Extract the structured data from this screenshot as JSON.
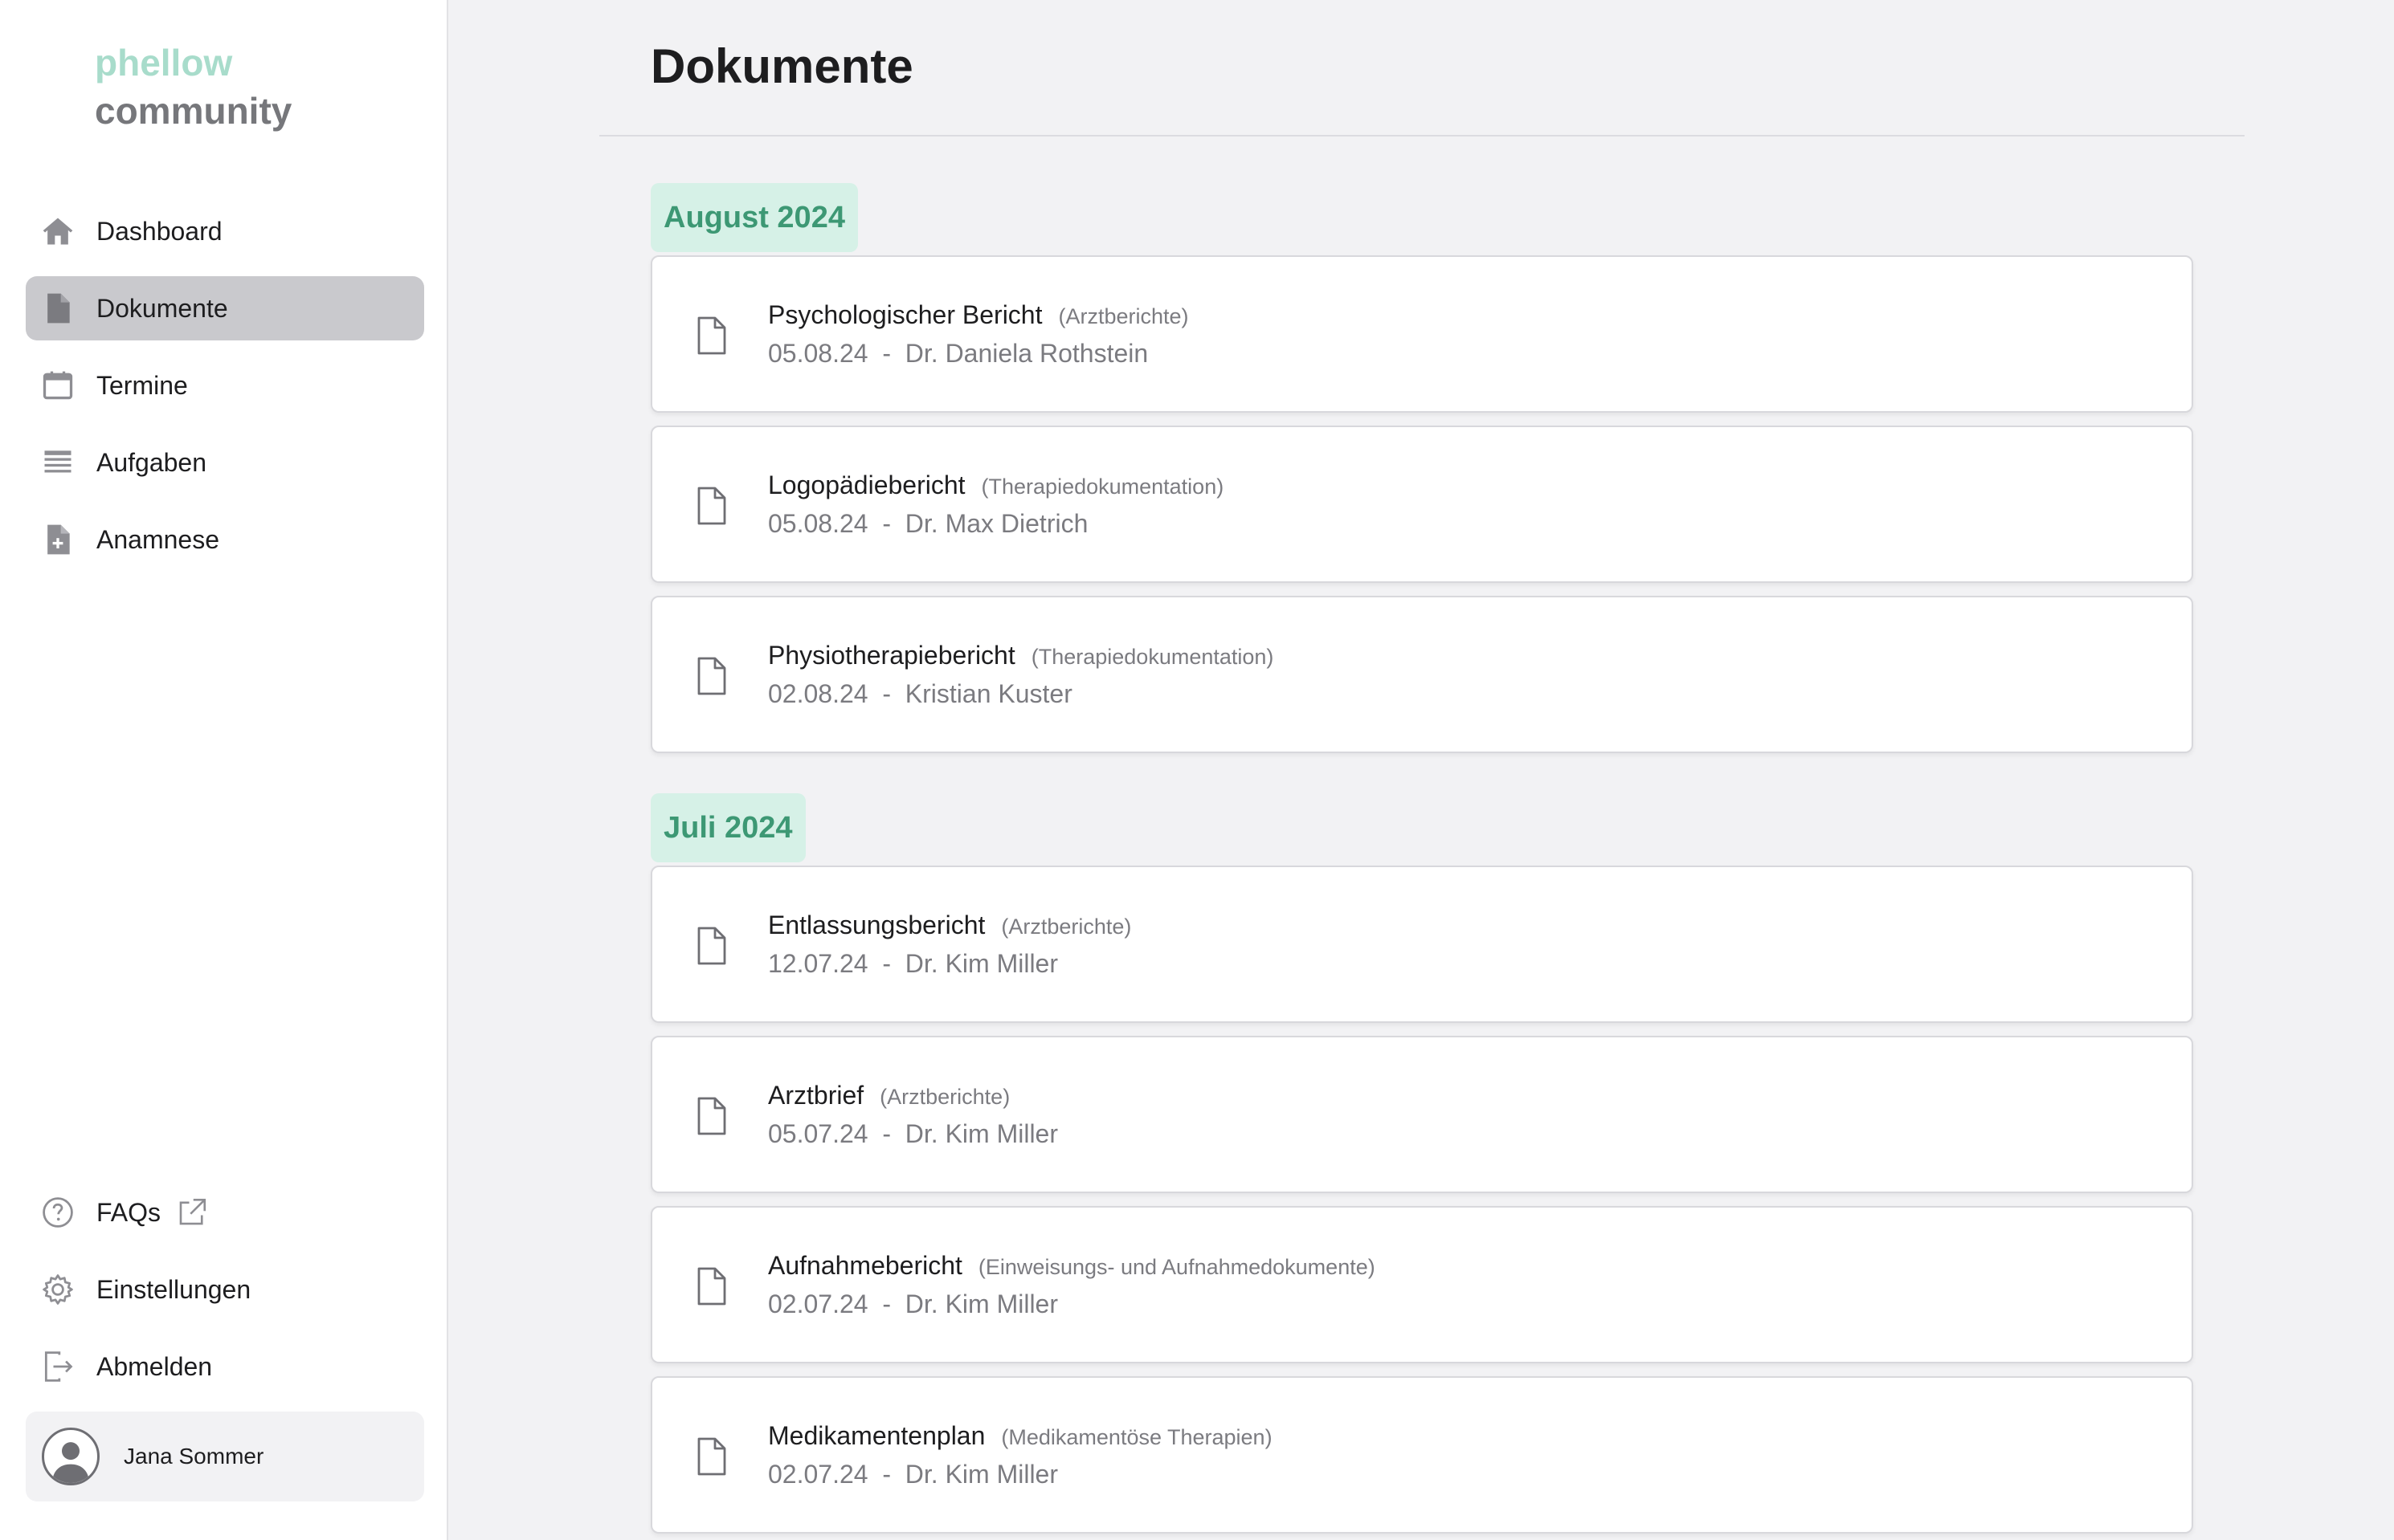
{
  "brand": {
    "line1": "phellow",
    "line2": "community"
  },
  "sidebar": {
    "items": [
      {
        "label": "Dashboard",
        "icon": "home-icon"
      },
      {
        "label": "Dokumente",
        "icon": "document-icon",
        "active": true
      },
      {
        "label": "Termine",
        "icon": "calendar-icon"
      },
      {
        "label": "Aufgaben",
        "icon": "list-icon"
      },
      {
        "label": "Anamnese",
        "icon": "document-plus-icon"
      }
    ],
    "bottom_items": [
      {
        "label": "FAQs",
        "icon": "question-circle-icon",
        "external": true
      },
      {
        "label": "Einstellungen",
        "icon": "gear-icon"
      },
      {
        "label": "Abmelden",
        "icon": "logout-icon"
      }
    ],
    "user": {
      "name": "Jana Sommer"
    }
  },
  "main": {
    "title": "Dokumente",
    "groups": [
      {
        "month": "August 2024",
        "documents": [
          {
            "title": "Psychologischer Bericht",
            "category": "(Arztberichte)",
            "date": "05.08.24",
            "author": "Dr. Daniela Rothstein"
          },
          {
            "title": "Logopädiebericht",
            "category": "(Therapiedokumentation)",
            "date": "05.08.24",
            "author": "Dr. Max Dietrich"
          },
          {
            "title": "Physiotherapiebericht",
            "category": "(Therapiedokumentation)",
            "date": "02.08.24",
            "author": "Kristian Kuster"
          }
        ]
      },
      {
        "month": "Juli 2024",
        "documents": [
          {
            "title": "Entlassungsbericht",
            "category": "(Arztberichte)",
            "date": "12.07.24",
            "author": "Dr. Kim Miller"
          },
          {
            "title": "Arztbrief",
            "category": "(Arztberichte)",
            "date": "05.07.24",
            "author": "Dr. Kim Miller"
          },
          {
            "title": "Aufnahmebericht",
            "category": "(Einweisungs- und Aufnahmedokumente)",
            "date": "02.07.24",
            "author": "Dr. Kim Miller"
          },
          {
            "title": "Medikamentenplan",
            "category": "(Medikamentöse Therapien)",
            "date": "02.07.24",
            "author": "Dr. Kim Miller"
          }
        ]
      }
    ],
    "separator": "-"
  },
  "colors": {
    "accent": "#3d9874",
    "badge_bg": "#d6f1e7",
    "active_nav_bg": "#c9c9cd",
    "page_bg": "#f2f2f4"
  }
}
